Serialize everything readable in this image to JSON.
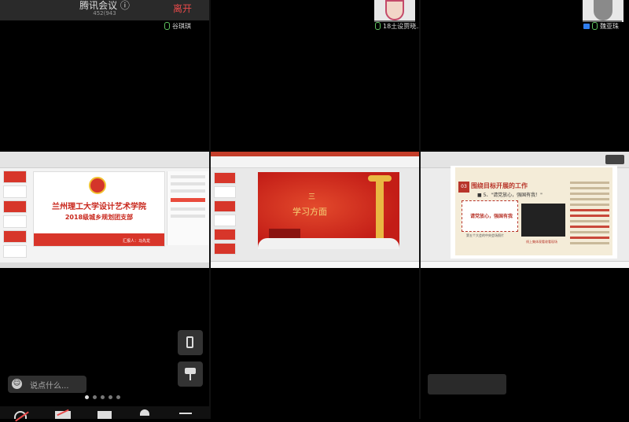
{
  "meeting": {
    "title": "腾讯会议 ⓘ",
    "meeting_id": "452(943",
    "leave_label": "离开"
  },
  "participants": [
    {
      "name": "谷琪琪",
      "mic": "on"
    },
    {
      "name": "18土设贾晓…",
      "mic": "on"
    },
    {
      "name": "魏亚珠",
      "mic": "on",
      "camera": "on"
    }
  ],
  "shares": {
    "slide1": {
      "title": "兰州理工大学设计艺术学院",
      "subtitle": "2018级城乡规划团支部",
      "signature": "汇报人：马先龙"
    },
    "slide2": {
      "number": "三",
      "heading": "学习方面"
    },
    "doc": {
      "badge": "03",
      "title": "围绕目标开展的工作",
      "subtitle": "■ 5、\"请党放心，强国有我！\"",
      "box_text": "请党放心，强国有我",
      "caption1": "第五个大会的中央会场照片",
      "caption2": "线上集体观看收看现场"
    }
  },
  "chat": {
    "emoji": "☺",
    "placeholder": "说点什么..."
  },
  "page_indicator": {
    "total": 5,
    "current": 1
  },
  "icons": [
    "phone-icon",
    "pin-icon",
    "mic-off-icon",
    "camera-off-icon",
    "share-screen-icon",
    "members-icon",
    "more-icon"
  ],
  "colors": {
    "accent_red": "#e84a4a",
    "mic_green": "#5fc35f",
    "party_red": "#c8261b"
  }
}
